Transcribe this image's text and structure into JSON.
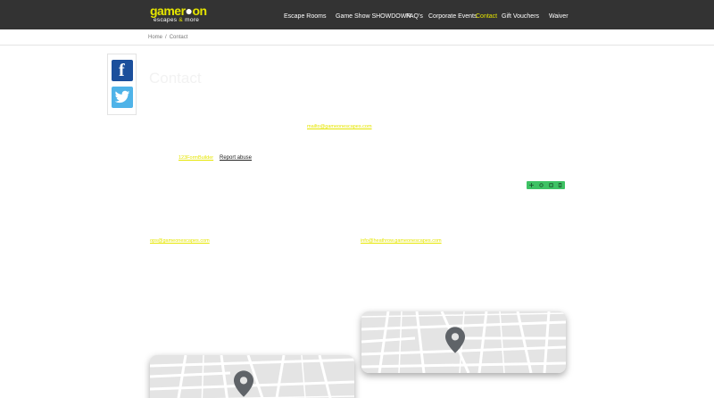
{
  "header": {
    "logo_main": "gamer",
    "logo_main_end": "on",
    "logo_sub_a": "escapes",
    "logo_sub_amp": "&",
    "logo_sub_b": "more",
    "nav": [
      {
        "label": "Escape Rooms",
        "active": false
      },
      {
        "label": "Game Show SHOWDOWN",
        "active": false
      },
      {
        "label": "FAQ's",
        "active": false
      },
      {
        "label": "Corporate Events",
        "active": false
      },
      {
        "label": "Contact",
        "active": true
      },
      {
        "label": "Gift Vouchers",
        "active": false
      },
      {
        "label": "Waiver",
        "active": false
      }
    ]
  },
  "breadcrumb": {
    "home": "Home",
    "separator": "/",
    "current": "Contact"
  },
  "page_title": "Contact",
  "links": {
    "email_main": "mailto@gameonescapes.com",
    "form_builder": "123FormBuilder",
    "report_abuse": "Report abuse",
    "email_left": "ops@gameonescapes.com",
    "email_right": "info@heathrow.gameonescapes.com"
  },
  "colors": {
    "header_bg": "#333333",
    "accent": "#e6e600",
    "toolbar": "#3ec264"
  },
  "icons": [
    "facebook-icon",
    "twitter-icon",
    "map-pin-icon",
    "move-icon",
    "settings-icon",
    "copy-icon",
    "delete-icon"
  ]
}
